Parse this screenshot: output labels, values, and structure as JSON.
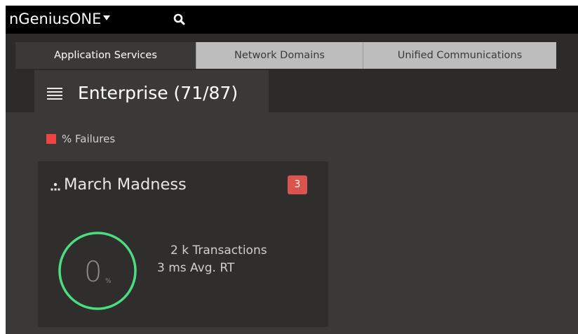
{
  "app": {
    "brand_strong": "nGenius",
    "brand_light": "ONE"
  },
  "tabs": [
    {
      "label": "Application Services",
      "active": true
    },
    {
      "label": "Network Domains",
      "active": false
    },
    {
      "label": "Unified Communications",
      "active": false
    }
  ],
  "context": {
    "title": "Enterprise (71/87)"
  },
  "legend": {
    "label": "% Failures",
    "color": "#ef4444"
  },
  "card": {
    "title": "March Madness",
    "badge": "3",
    "gauge_value": "0",
    "gauge_unit": "%",
    "gauge_color": "#4ade80",
    "transactions": "2 k Transactions",
    "avg_rt": "3 ms Avg. RT"
  },
  "icons": {
    "search": "search-icon",
    "menu": "hamburger-menu-icon",
    "service": "service-group-icon",
    "brand_menu": "caret-down-icon"
  },
  "colors": {
    "background": "#3a3938",
    "topbar": "#000000",
    "badge": "#d9534f"
  }
}
